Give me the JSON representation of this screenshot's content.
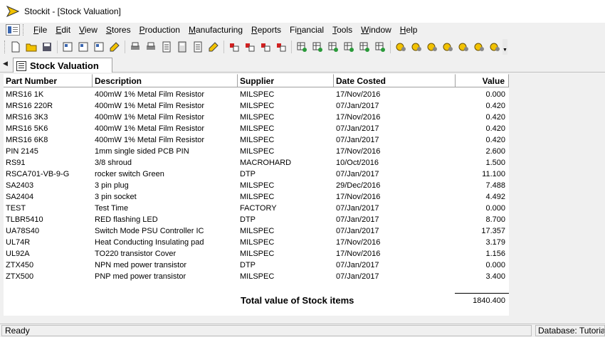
{
  "window": {
    "title": "Stockit - [Stock Valuation]"
  },
  "menu": [
    {
      "pre": "",
      "acc": "F",
      "post": "ile"
    },
    {
      "pre": "",
      "acc": "E",
      "post": "dit"
    },
    {
      "pre": "",
      "acc": "V",
      "post": "iew"
    },
    {
      "pre": "",
      "acc": "S",
      "post": "tores"
    },
    {
      "pre": "",
      "acc": "P",
      "post": "roduction"
    },
    {
      "pre": "",
      "acc": "M",
      "post": "anufacturing"
    },
    {
      "pre": "",
      "acc": "R",
      "post": "eports"
    },
    {
      "pre": "Fi",
      "acc": "n",
      "post": "ancial"
    },
    {
      "pre": "",
      "acc": "T",
      "post": "ools"
    },
    {
      "pre": "",
      "acc": "W",
      "post": "indow"
    },
    {
      "pre": "",
      "acc": "H",
      "post": "elp"
    }
  ],
  "tab": {
    "label": "Stock Valuation"
  },
  "table": {
    "columns": [
      "Part Number",
      "Description",
      "Supplier",
      "Date Costed",
      "Value"
    ],
    "rows": [
      [
        "MRS16 1K",
        "400mW 1% Metal Film Resistor",
        "MILSPEC",
        "17/Nov/2016",
        "0.000"
      ],
      [
        "MRS16 220R",
        "400mW 1% Metal Film Resistor",
        "MILSPEC",
        "07/Jan/2017",
        "0.420"
      ],
      [
        "MRS16 3K3",
        "400mW 1% Metal Film Resistor",
        "MILSPEC",
        "17/Nov/2016",
        "0.420"
      ],
      [
        "MRS16 5K6",
        "400mW 1% Metal Film Resistor",
        "MILSPEC",
        "07/Jan/2017",
        "0.420"
      ],
      [
        "MRS16 6K8",
        "400mW 1% Metal Film Resistor",
        "MILSPEC",
        "07/Jan/2017",
        "0.420"
      ],
      [
        "PIN 2145",
        "1mm single sided PCB PIN",
        "MILSPEC",
        "17/Nov/2016",
        "2.600"
      ],
      [
        "RS91",
        "3/8 shroud",
        "MACROHARD",
        "10/Oct/2016",
        "1.500"
      ],
      [
        "RSCA701-VB-9-G",
        "rocker switch Green",
        "DTP",
        "07/Jan/2017",
        "11.100"
      ],
      [
        "SA2403",
        "3 pin plug",
        "MILSPEC",
        "29/Dec/2016",
        "7.488"
      ],
      [
        "SA2404",
        "3 pin socket",
        "MILSPEC",
        "17/Nov/2016",
        "4.492"
      ],
      [
        "TEST",
        "Test Time",
        "FACTORY",
        "07/Jan/2017",
        "0.000"
      ],
      [
        "TLBR5410",
        "RED flashing LED",
        "DTP",
        "07/Jan/2017",
        "8.700"
      ],
      [
        "UA78S40",
        "Switch Mode PSU Controller IC",
        "MILSPEC",
        "07/Jan/2017",
        "17.357"
      ],
      [
        "UL74R",
        "Heat Conducting Insulating pad",
        "MILSPEC",
        "17/Nov/2016",
        "3.179"
      ],
      [
        "UL92A",
        "TO220 transistor Cover",
        "MILSPEC",
        "17/Nov/2016",
        "1.156"
      ],
      [
        "ZTX450",
        "NPN med power transistor",
        "DTP",
        "07/Jan/2017",
        "0.000"
      ],
      [
        "ZTX500",
        "PNP med power transistor",
        "MILSPEC",
        "07/Jan/2017",
        "3.400"
      ]
    ]
  },
  "total": {
    "label": "Total value of Stock items",
    "value": "1840.400"
  },
  "status": {
    "left": "Ready",
    "right": "Database: Tutorial"
  },
  "toolbar_icons": [
    "new-icon",
    "open-folder-icon",
    "save-icon",
    "sep",
    "store-transfer-icon",
    "stock-items-icon",
    "stock-list-icon",
    "tag-icon",
    "sep",
    "print-icon",
    "print-preview-icon",
    "report-icon",
    "calculator-icon",
    "worksheet-icon",
    "edit-icon",
    "sep",
    "parts-red-icon",
    "parts-add-icon",
    "parts-remove-icon",
    "parts-move-icon",
    "sep",
    "grid-add-icon",
    "grid-gray-icon",
    "grid-move-icon",
    "grid-link-icon",
    "grid-swap-icon",
    "grid-stock-icon",
    "sep",
    "build-icon",
    "build-gray-icon",
    "build-2-icon",
    "build-3-icon",
    "build-4-icon",
    "build-run-icon",
    "build-stop-icon"
  ],
  "colors": {
    "accent_yellow": "#f2c200",
    "accent_red": "#d02020",
    "accent_green": "#2a9a3a",
    "accent_blue": "#3a66b0"
  }
}
